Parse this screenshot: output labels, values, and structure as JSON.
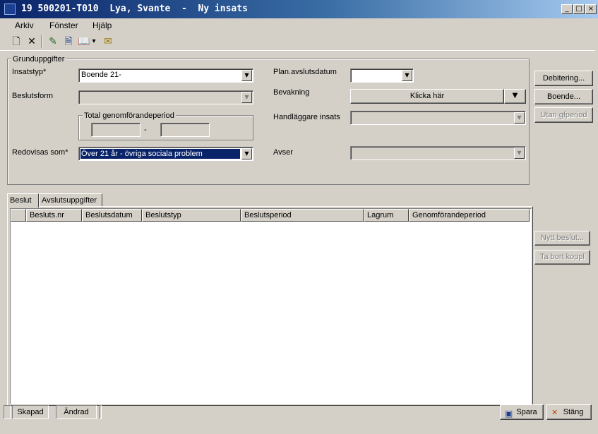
{
  "window": {
    "title": "19 500201-T010  Lya, Svante  -  Ny insats",
    "minimize_glyph": "_",
    "maximize_glyph": "□",
    "close_glyph": "×"
  },
  "menu": {
    "arkiv": "Arkiv",
    "fonster": "Fönster",
    "hjalp": "Hjälp"
  },
  "toolbar": {
    "new_icon": "🗋",
    "delete_icon": "✕",
    "edit_icon": "✎",
    "doc_icon": "🗎",
    "book_icon": "📖",
    "dropdown_glyph": "▾",
    "mail_icon": "✉"
  },
  "grunduppgifter": {
    "legend": "Grunduppgifter",
    "insatstyp_label": "Insatstyp*",
    "insatstyp_value": "Boende 21-",
    "beslutsform_label": "Beslutsform",
    "beslutsform_value": "",
    "period_legend": "Total genomförandeperiod",
    "period_from": "",
    "period_dash": "-",
    "period_to": "",
    "redovisas_label": "Redovisas som*",
    "redovisas_value": "Över 21 år - övriga sociala problem",
    "plan_label": "Plan.avslutsdatum",
    "plan_value": "",
    "bevakning_label": "Bevakning",
    "bevakning_button": "Klicka här",
    "handlaggare_label": "Handläggare insats",
    "handlaggare_value": "",
    "avser_label": "Avser",
    "avser_value": ""
  },
  "side_buttons": {
    "debitering": "Debitering...",
    "boende": "Boende...",
    "utan_gfperiod": "Utan gfperiod"
  },
  "tabs": {
    "beslut": "Beslut",
    "avslutsuppgifter": "Avslutsuppgifter"
  },
  "grid": {
    "columns": [
      "",
      "Besluts.nr",
      "Beslutsdatum",
      "Beslutstyp",
      "Beslutsperiod",
      "Lagrum",
      "Genomförandeperiod"
    ],
    "rows": []
  },
  "grid_buttons": {
    "nytt_beslut": "Nytt beslut...",
    "ta_bort_koppl": "Ta bort koppl"
  },
  "status": {
    "skapad": "Skapad",
    "andrad": "Ändrad"
  },
  "footer": {
    "spara": "Spara",
    "stang": "Stäng"
  },
  "colors": {
    "titlebar_start": "#0a246a",
    "titlebar_end": "#a6caf0",
    "face": "#d4d0c8",
    "selection": "#0a246a"
  }
}
